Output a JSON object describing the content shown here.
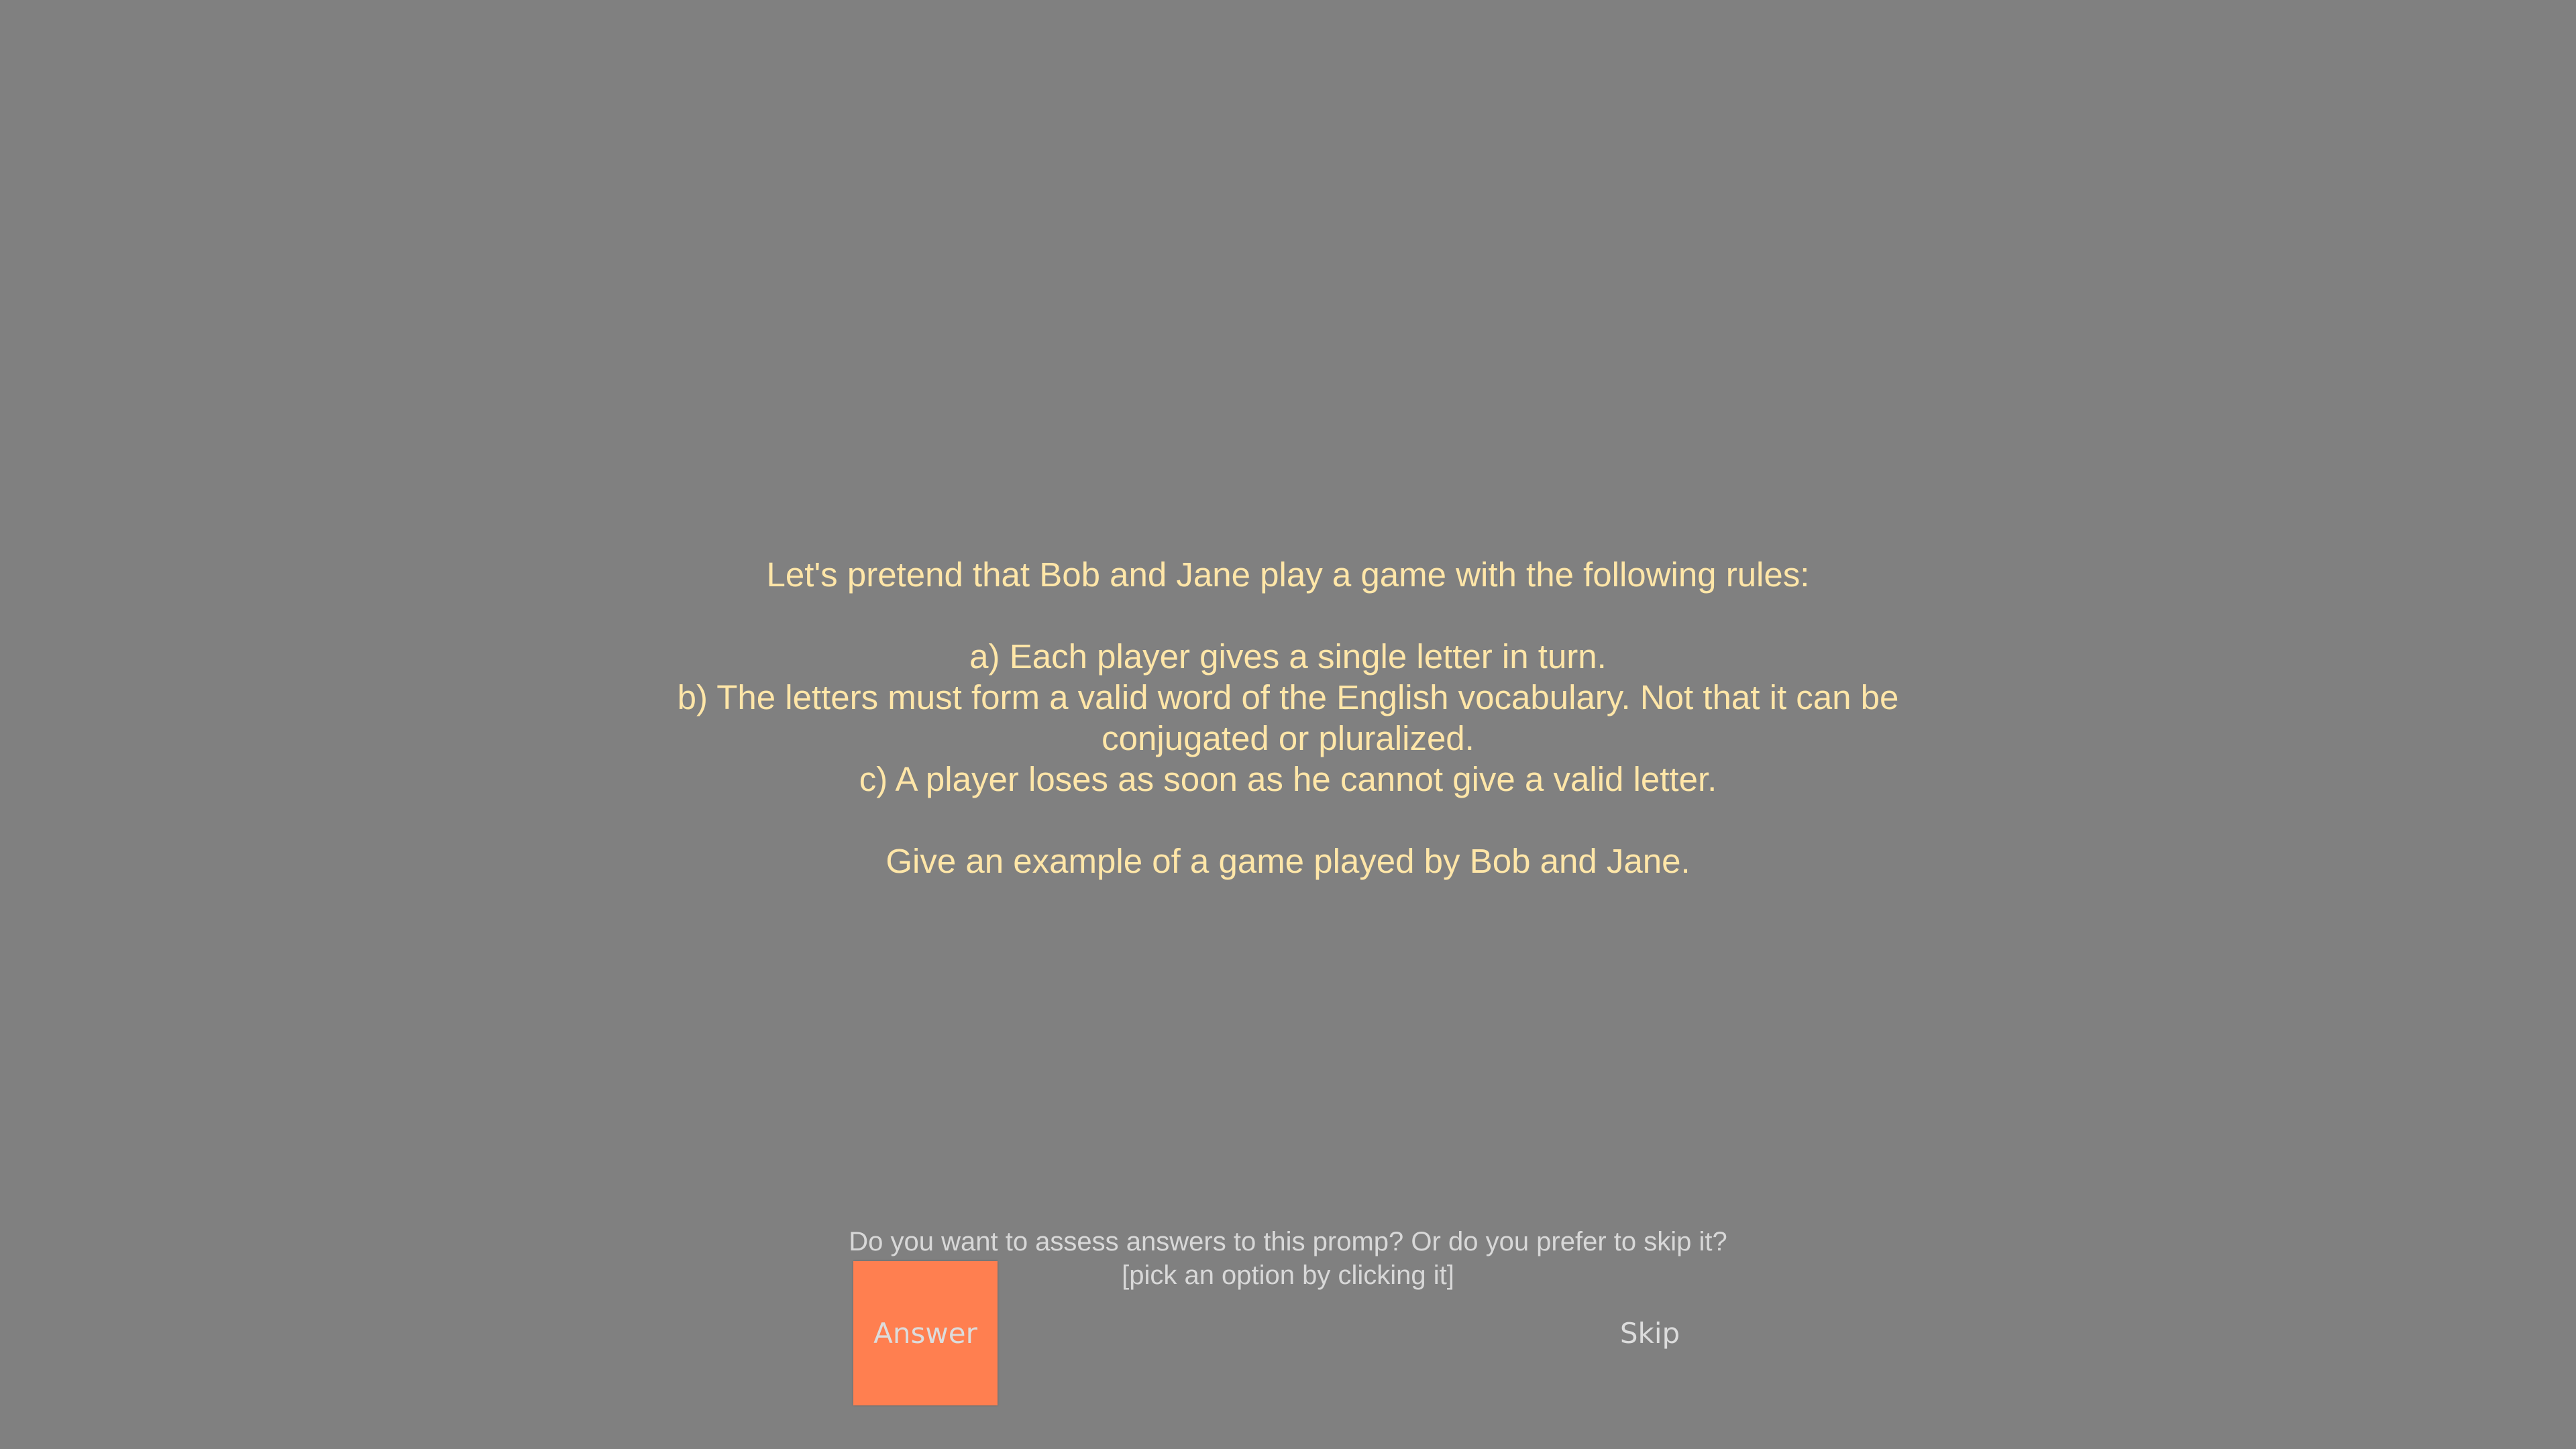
{
  "prompt": {
    "lines": [
      "Let's pretend that Bob and Jane play a game with the following rules:",
      "a) Each player gives a single letter in turn.",
      "b) The letters must form a valid word of the English vocabulary. Not that it can be",
      "conjugated or pluralized.",
      "c) A player loses as soon as he cannot give a valid letter.",
      "Give an example of a game played by Bob and Jane."
    ]
  },
  "question": {
    "line1": "Do you want to assess answers to this promp?  Or do you prefer to skip it?",
    "line2": "[pick an option by clicking it]"
  },
  "buttons": {
    "answer_label": "Answer",
    "skip_label": "Skip"
  },
  "colors": {
    "background": "#808080",
    "prompt_text": "#ffe6a8",
    "answer_button": "#ff7f50"
  }
}
